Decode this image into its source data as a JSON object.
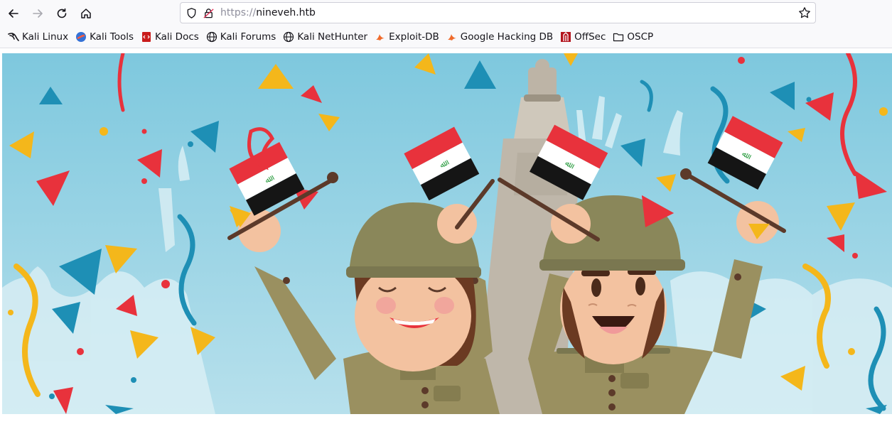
{
  "toolbar": {
    "back_icon": "arrow-left-icon",
    "forward_icon": "arrow-right-icon",
    "reload_icon": "reload-icon",
    "home_icon": "home-icon"
  },
  "urlbar": {
    "scheme": "https://",
    "host": "nineveh.htb",
    "shield_icon": "shield-icon",
    "lock_icon": "lock-icon",
    "star_icon": "star-icon"
  },
  "bookmarks": [
    {
      "label": "Kali Linux",
      "icon": "kali-dragon-icon"
    },
    {
      "label": "Kali Tools",
      "icon": "kali-tools-icon"
    },
    {
      "label": "Kali Docs",
      "icon": "kali-docs-icon"
    },
    {
      "label": "Kali Forums",
      "icon": "globe-icon"
    },
    {
      "label": "Kali NetHunter",
      "icon": "globe-icon"
    },
    {
      "label": "Exploit-DB",
      "icon": "exploit-db-icon"
    },
    {
      "label": "Google Hacking DB",
      "icon": "exploit-db-icon"
    },
    {
      "label": "OffSec",
      "icon": "offsec-icon"
    },
    {
      "label": "OSCP",
      "icon": "folder-icon"
    }
  ],
  "colors": {
    "sky": "#7ec8de",
    "flag_red": "#e8323c",
    "flag_black": "#151515",
    "flag_green": "#2f9e44",
    "uniform": "#9a9060",
    "helmet": "#8a875a"
  }
}
